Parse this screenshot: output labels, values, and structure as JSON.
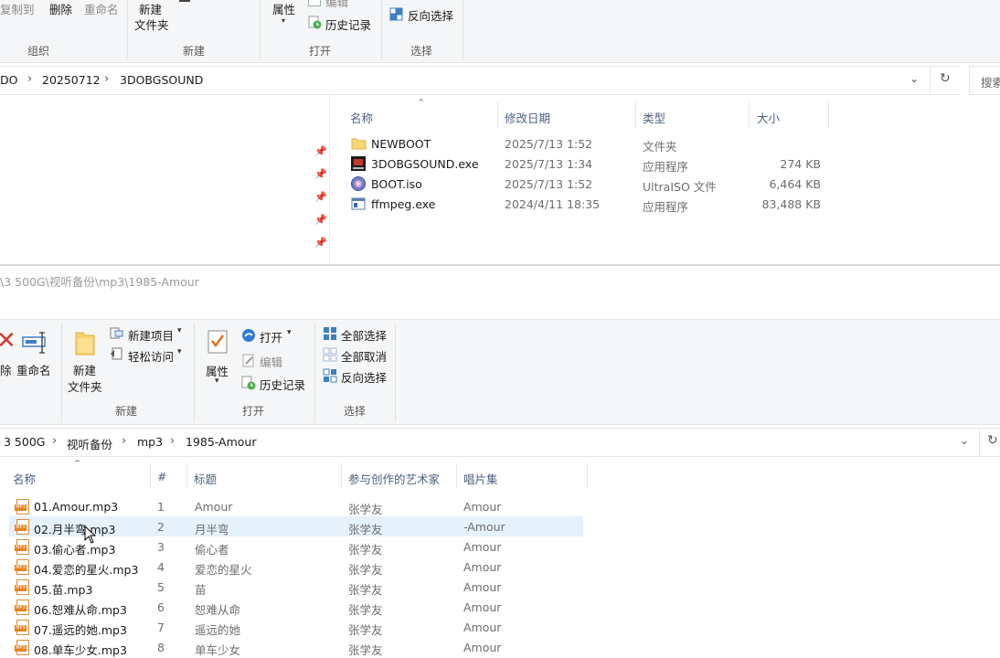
{
  "win1": {
    "ribbon": {
      "copy_to": "复制到",
      "delete": "删除",
      "rename": "重命名",
      "new_folder_l1": "新建",
      "new_folder_l2": "文件夹",
      "properties": "属性",
      "edit": "编辑",
      "history": "历史记录",
      "invert_select": "反向选择",
      "groups": {
        "organize": "组织",
        "new": "新建",
        "open": "打开",
        "select": "选择"
      }
    },
    "address": {
      "crumbs": [
        "DO",
        "20250712",
        "3DOBGSOUND"
      ],
      "search": "搜索"
    },
    "columns": {
      "name": "名称",
      "modified": "修改日期",
      "type": "类型",
      "size": "大小"
    },
    "files": [
      {
        "name": "NEWBOOT",
        "modified": "2025/7/13 1:52",
        "type": "文件夹",
        "size": "",
        "icon": "folder-icon"
      },
      {
        "name": "3DOBGSOUND.exe",
        "modified": "2025/7/13 1:34",
        "type": "应用程序",
        "size": "274 KB",
        "icon": "exe-icon"
      },
      {
        "name": "BOOT.iso",
        "modified": "2025/7/13 1:52",
        "type": "UltraISO 文件",
        "size": "6,464 KB",
        "icon": "disc-icon"
      },
      {
        "name": "ffmpeg.exe",
        "modified": "2024/4/11 18:35",
        "type": "应用程序",
        "size": "83,488 KB",
        "icon": "app-icon"
      }
    ]
  },
  "win2": {
    "title_path": "\\3 500G\\视听备份\\mp3\\1985-Amour",
    "ribbon": {
      "delete_frag": "除",
      "rename": "重命名",
      "new_folder_l1": "新建",
      "new_folder_l2": "文件夹",
      "new_item": "新建项目",
      "easy_access": "轻松访问",
      "properties": "属性",
      "open": "打开",
      "edit": "编辑",
      "history": "历史记录",
      "select_all": "全部选择",
      "select_none": "全部取消",
      "invert_select": "反向选择",
      "groups": {
        "new": "新建",
        "open": "打开",
        "select": "选择"
      }
    },
    "address": {
      "crumbs": [
        "3 500G",
        "视听备份",
        "mp3",
        "1985-Amour"
      ]
    },
    "columns": {
      "name": "名称",
      "num": "#",
      "title": "标题",
      "artist": "参与创作的艺术家",
      "album": "唱片集"
    },
    "files": [
      {
        "name": "01.Amour.mp3",
        "num": "1",
        "title": "Amour",
        "artist": "张学友",
        "album": "Amour"
      },
      {
        "name": "02.月半弯.mp3",
        "num": "2",
        "title": "月半弯",
        "artist": "张学友",
        "album": "-Amour"
      },
      {
        "name": "03.偷心者.mp3",
        "num": "3",
        "title": "偷心者",
        "artist": "张学友",
        "album": "Amour"
      },
      {
        "name": "04.爱恋的星火.mp3",
        "num": "4",
        "title": "爱恋的星火",
        "artist": "张学友",
        "album": "Amour"
      },
      {
        "name": "05.苗.mp3",
        "num": "5",
        "title": "苗",
        "artist": "张学友",
        "album": "Amour"
      },
      {
        "name": "06.恕难从命.mp3",
        "num": "6",
        "title": "恕难从命",
        "artist": "张学友",
        "album": "Amour"
      },
      {
        "name": "07.遥远的她.mp3",
        "num": "7",
        "title": "遥远的她",
        "artist": "张学友",
        "album": "Amour"
      },
      {
        "name": "08.单车少女.mp3",
        "num": "8",
        "title": "单车少女",
        "artist": "张学友",
        "album": "Amour"
      }
    ],
    "selected_index": 1
  }
}
